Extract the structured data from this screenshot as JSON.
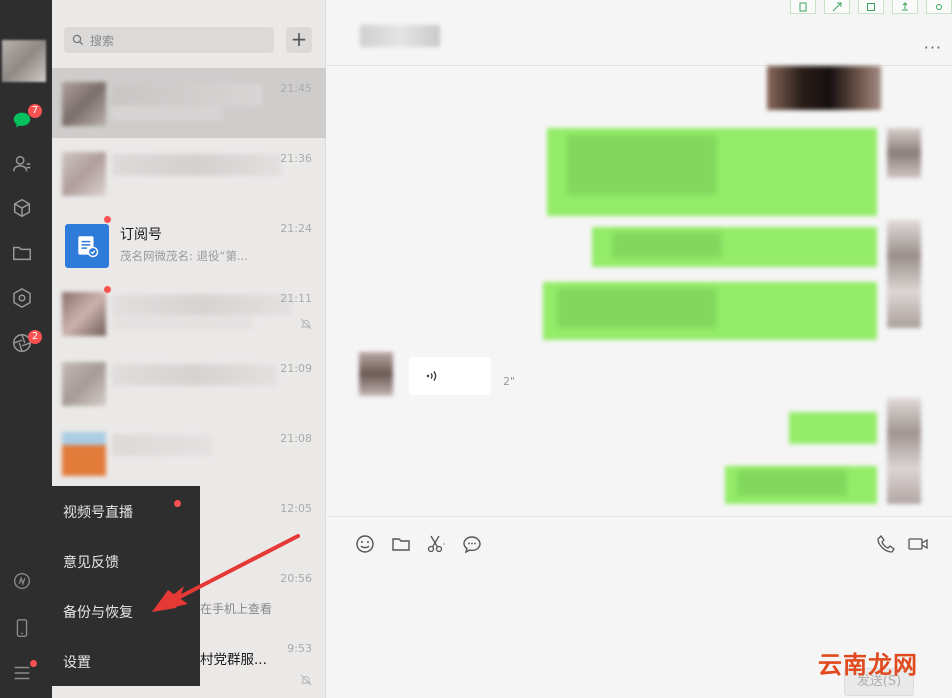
{
  "sidebar": {
    "chat_badge": "7",
    "moments_badge": "2"
  },
  "search": {
    "placeholder": "搜索",
    "add_label": "+"
  },
  "conversations": [
    {
      "time": "21:45"
    },
    {
      "time": "21:36"
    },
    {
      "time": "21:24",
      "name": "订阅号",
      "preview": "茂名网微茂名: 退役“第..."
    },
    {
      "time": "21:11"
    },
    {
      "time": "21:09"
    },
    {
      "time": "21:08"
    },
    {
      "time": "12:05"
    },
    {
      "time": "20:56",
      "preview": "在手机上查看"
    },
    {
      "time": "9:53",
      "name": "村党群服..."
    }
  ],
  "menu": {
    "items": [
      "视频号直播",
      "意见反馈",
      "备份与恢复",
      "设置"
    ]
  },
  "chat": {
    "more": "···",
    "voice_length": "2\"",
    "send_label": "发送(S)"
  },
  "watermark": "云南龙网",
  "colors": {
    "rail": "#2e2e2e",
    "bubble_green": "#95ec69",
    "badge_red": "#fa5151",
    "arrow_red": "#e53935"
  }
}
